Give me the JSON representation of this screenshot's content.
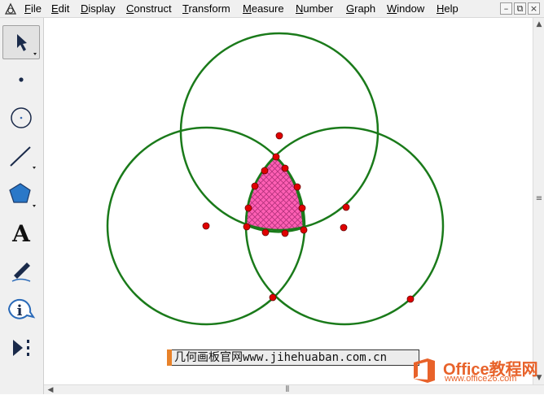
{
  "menubar": {
    "items": [
      "File",
      "Edit",
      "Display",
      "Construct",
      "Transform",
      "Measure",
      "Number",
      "Graph",
      "Window",
      "Help"
    ],
    "mnemonics": [
      "F",
      "E",
      "D",
      "C",
      "T",
      "M",
      "N",
      "G",
      "W",
      "H"
    ]
  },
  "window_controls": {
    "minimize": "–",
    "restore": "⧉",
    "close": "×"
  },
  "toolbar": {
    "tools": [
      "arrow-select-tool",
      "point-tool",
      "compass-tool",
      "straightedge-tool",
      "polygon-tool",
      "text-tool",
      "marker-tool",
      "information-tool",
      "custom-tools"
    ],
    "text_tool_glyph": "A",
    "info_tool_glyph": "i"
  },
  "canvas": {
    "caption_text": "几何画板官网www.jihehuaban.com.cn",
    "colors": {
      "circle": "#1a7a1a",
      "point": "#e00000",
      "region_fill": "#ff5fb4",
      "region_hatch": "#b0307a"
    }
  },
  "watermark": {
    "title": "Office教程网",
    "url": "www.office26.com",
    "color": "#e8622a"
  }
}
